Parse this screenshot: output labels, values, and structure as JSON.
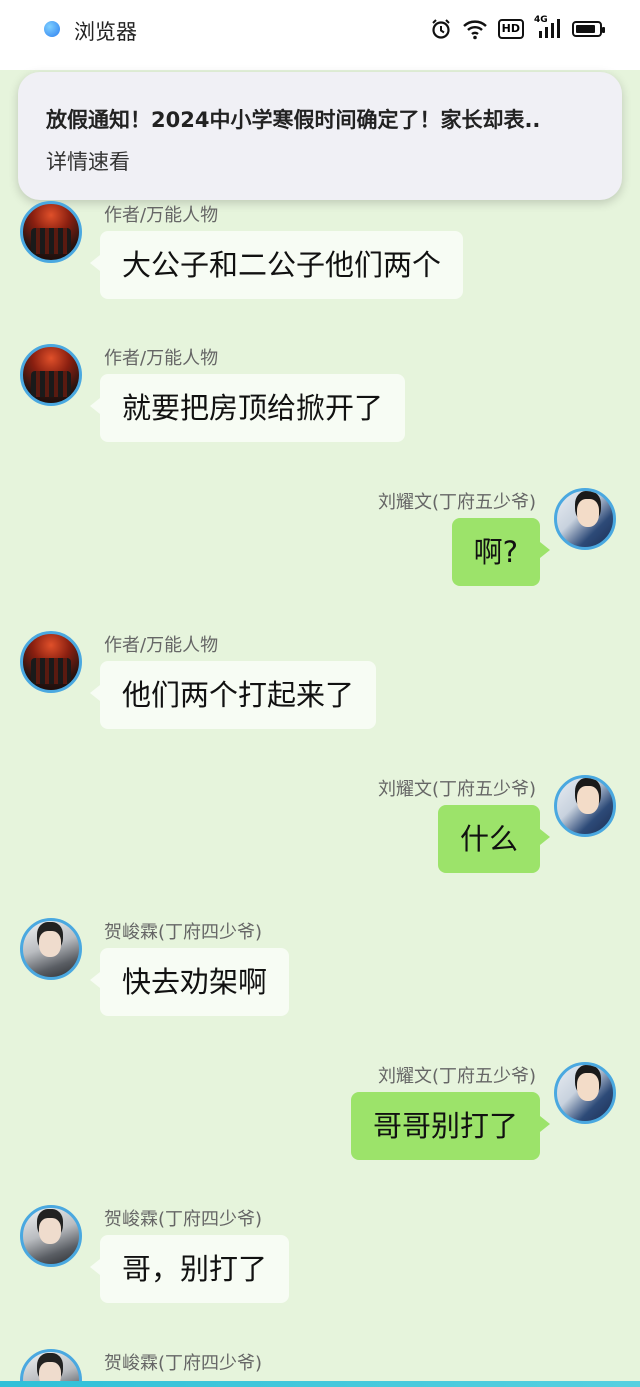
{
  "status_bar": {
    "app_name": "浏览器",
    "hd_label": "HD",
    "network": "4G",
    "battery_level_percent": 85
  },
  "notification": {
    "title": "放假通知！2024中小学寒假时间确定了！家长却表..",
    "subtitle": "详情速看"
  },
  "messages": [
    {
      "side": "left",
      "sender": "作者/万能人物",
      "text": "大公子和二公子他们两个",
      "avatar": "avatar-red-group"
    },
    {
      "side": "left",
      "sender": "作者/万能人物",
      "text": "就要把房顶给掀开了",
      "avatar": "avatar-red-group"
    },
    {
      "side": "right",
      "sender": "刘耀文(丁府五少爷)",
      "text": "啊?",
      "avatar": "avatar-blue-portrait"
    },
    {
      "side": "left",
      "sender": "作者/万能人物",
      "text": "他们两个打起来了",
      "avatar": "avatar-red-group"
    },
    {
      "side": "right",
      "sender": "刘耀文(丁府五少爷)",
      "text": "什么",
      "avatar": "avatar-blue-portrait"
    },
    {
      "side": "left",
      "sender": "贺峻霖(丁府四少爷)",
      "text": "快去劝架啊",
      "avatar": "avatar-gray-portrait"
    },
    {
      "side": "right",
      "sender": "刘耀文(丁府五少爷)",
      "text": "哥哥别打了",
      "avatar": "avatar-blue-portrait"
    },
    {
      "side": "left",
      "sender": "贺峻霖(丁府四少爷)",
      "text": "哥，别打了",
      "avatar": "avatar-gray-portrait"
    },
    {
      "side": "left",
      "sender": "贺峻霖(丁府四少爷)",
      "text": "",
      "avatar": "avatar-gray-portrait"
    }
  ],
  "colors": {
    "chat_background": "#e6f4dc",
    "outgoing_bubble": "#9ce36a",
    "incoming_bubble": "#f7fcf4",
    "avatar_ring": "#4aa8e0"
  }
}
